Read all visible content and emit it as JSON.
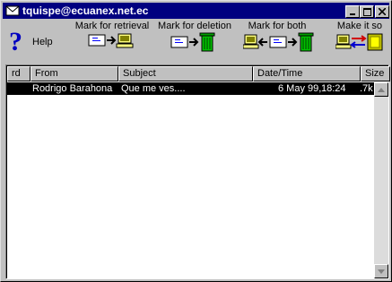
{
  "window": {
    "title": "tquispe@ecuanex.net.ec"
  },
  "toolbar": {
    "help_label": "Help",
    "retrieval_label": "Mark for retrieval",
    "deletion_label": "Mark for deletion",
    "both_label": "Mark for both",
    "make_label": "Make it so"
  },
  "columns": [
    "rd",
    "From",
    "Subject",
    "Date/Time",
    "Size"
  ],
  "messages": [
    {
      "from": "Rodrigo Barahona",
      "subject": "Que me ves....",
      "date": "6 May 99,",
      "time": "18:24",
      "size": ".7k"
    }
  ],
  "colors": {
    "titlebar": "#000080",
    "selection": "#000000",
    "face": "#c0c0c0"
  }
}
